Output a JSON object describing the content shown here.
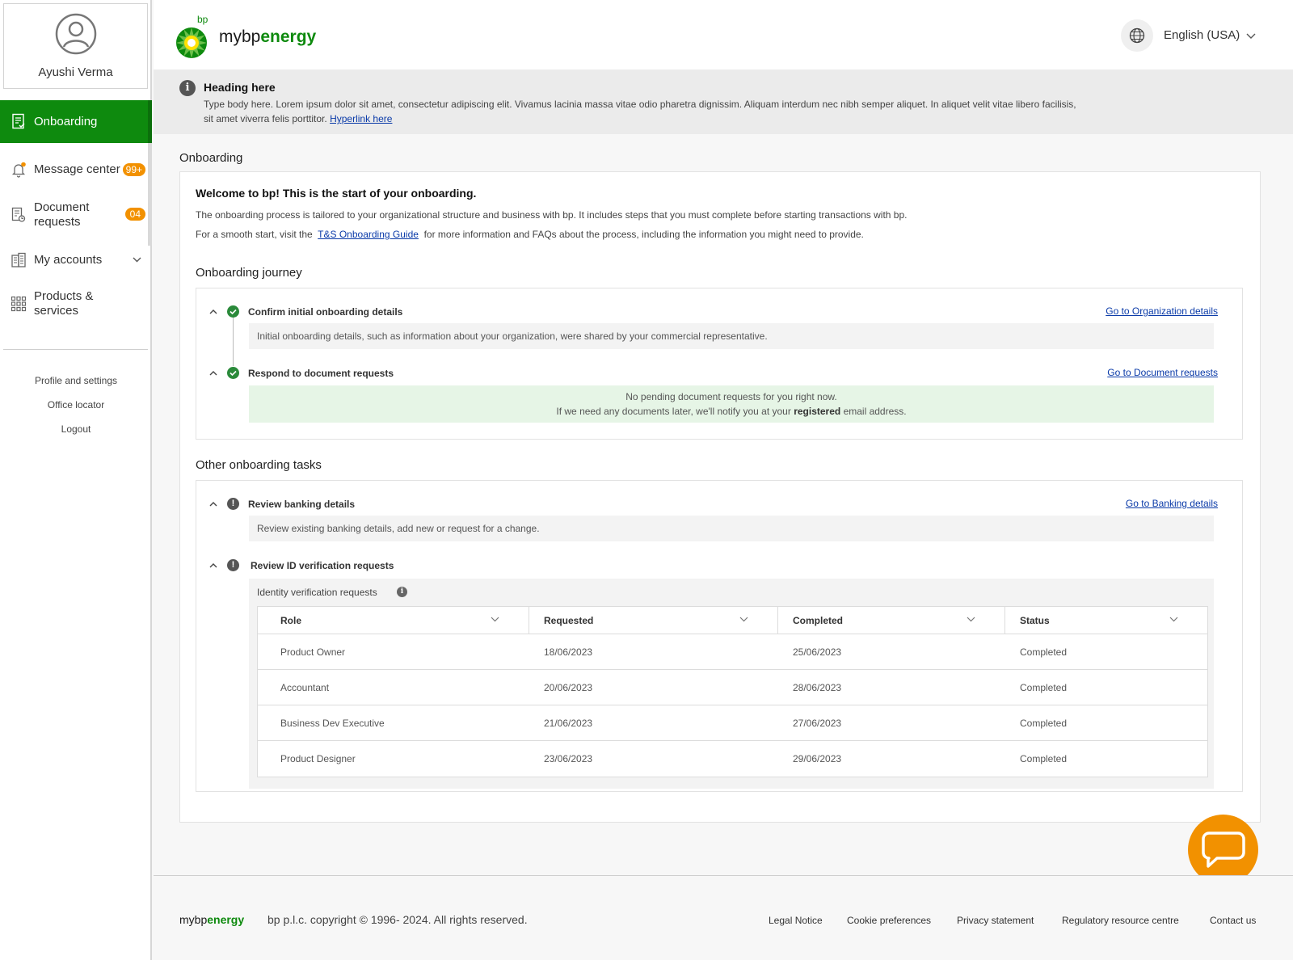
{
  "user": {
    "name": "Ayushi Verma"
  },
  "sidebar": {
    "items": [
      {
        "label": "Onboarding"
      },
      {
        "label": "Message center",
        "badge": "99+"
      },
      {
        "label_line1": "Document",
        "label_line2": "requests",
        "badge": "04"
      },
      {
        "label": "My accounts"
      },
      {
        "label_line1": "Products &",
        "label_line2": "services"
      }
    ],
    "links": [
      "Profile and settings",
      "Office locator",
      "Logout"
    ]
  },
  "header": {
    "brand_small": "bp",
    "brand_prefix": "mybp",
    "brand_suffix": "energy",
    "language": "English (USA)"
  },
  "banner": {
    "title": "Heading here",
    "body": "Type body here. Lorem ipsum dolor sit amet, consectetur adipiscing elit. Vivamus lacinia massa vitae odio pharetra dignissim. Aliquam interdum nec nibh semper aliquet. In aliquet velit vitae libero facilisis, sit amet viverra felis porttitor.",
    "link": "Hyperlink here"
  },
  "page": {
    "heading": "Onboarding",
    "welcome": "Welcome to bp! This is the start of your onboarding.",
    "intro1": "The onboarding process is tailored to your organizational structure and business with bp. It includes steps that you must complete before starting transactions with bp.",
    "intro2_before": "For a smooth start, visit the",
    "intro2_link": "T&S Onboarding Guide",
    "intro2_after": "for more information and FAQs about the process, including the information you might need to provide."
  },
  "journey": {
    "title": "Onboarding journey",
    "steps": [
      {
        "title": "Confirm initial onboarding details",
        "link": "Go to Organization details",
        "body": "Initial onboarding details, such as information about your organization, were shared by your commercial representative."
      },
      {
        "title": "Respond to document requests",
        "link": "Go to Document requests",
        "body_line1": "No pending document requests for you right now.",
        "body_line2_before": "If we need any documents later, we'll notify you at your",
        "body_line2_bold": "registered",
        "body_line2_after": "email address."
      }
    ]
  },
  "other": {
    "title": "Other onboarding tasks",
    "banking": {
      "title": "Review banking details",
      "link": "Go to Banking details",
      "body": "Review existing banking details, add new or request for a change."
    },
    "id": {
      "title": "Review ID verification requests",
      "table_label": "Identity verification requests",
      "columns": [
        "Role",
        "Requested",
        "Completed",
        "Status"
      ],
      "rows": [
        [
          "Product Owner",
          "18/06/2023",
          "25/06/2023",
          "Completed"
        ],
        [
          "Accountant",
          "20/06/2023",
          "28/06/2023",
          "Completed"
        ],
        [
          "Business Dev Executive",
          "21/06/2023",
          "27/06/2023",
          "Completed"
        ],
        [
          "Product Designer",
          "23/06/2023",
          "29/06/2023",
          "Completed"
        ]
      ]
    }
  },
  "footer": {
    "brand_prefix": "mybp",
    "brand_suffix": "energy",
    "copyright": "bp p.l.c. copyright © 1996- 2024. All rights reserved.",
    "links": [
      "Legal Notice",
      "Cookie preferences",
      "Privacy statement",
      "Regulatory resource centre",
      "Contact us"
    ]
  },
  "colors": {
    "brand_green": "#0e8a0e",
    "accent_orange": "#f29100",
    "link_blue": "#0a3aa8",
    "success_green": "#2a8a3a"
  }
}
